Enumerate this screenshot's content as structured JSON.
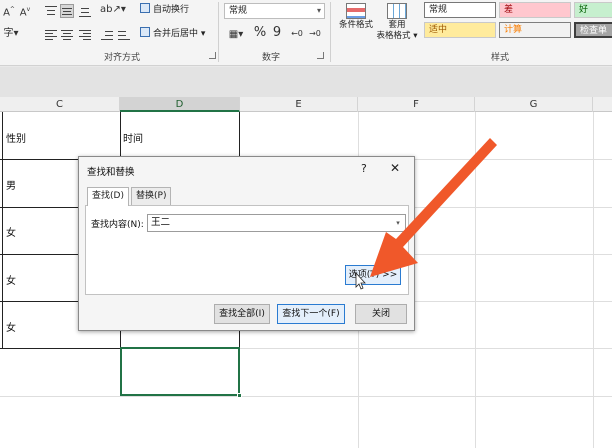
{
  "ribbon": {
    "wrap_text_label": "自动换行",
    "merge_center_label": "合并后居中",
    "alignment_group_label": "对齐方式",
    "number_format_value": "常规",
    "number_group_label": "数字",
    "percent_symbol": "%",
    "comma_symbol": "9",
    "conditional_format_line1": "条件格式",
    "format_table_line1": "套用",
    "format_table_line2": "表格格式",
    "styles_group_label": "样式",
    "styles": {
      "normal": "常规",
      "bad": "差",
      "good": "好",
      "neutral": "适中",
      "calculation": "计算",
      "check_cell": "检查单"
    },
    "colors": {
      "bad_bg": "#ffc7ce",
      "bad_fg": "#9c0006",
      "good_bg": "#c6efce",
      "good_fg": "#006100",
      "neutral_bg": "#ffeb9c",
      "neutral_fg": "#9c5700",
      "calc_bg": "#f2f2f2",
      "calc_fg": "#fa7d00",
      "check_bg": "#a5a5a5"
    }
  },
  "sheet": {
    "columns": [
      "C",
      "D",
      "E",
      "F",
      "G"
    ],
    "selected_column": "D",
    "header_gender": "性别",
    "header_time": "时间",
    "rows": [
      "男",
      "女",
      "女",
      "女"
    ]
  },
  "dialog": {
    "title": "查找和替换",
    "help": "?",
    "close": "✕",
    "tab_find": "查找(D)",
    "tab_replace": "替换(P)",
    "find_label": "查找内容(N):",
    "find_value": "王二",
    "options_button": "选项(T) >>",
    "find_all_button": "查找全部(I)",
    "find_next_button": "查找下一个(F)",
    "close_button": "关闭",
    "accent_color": "#2a7bd1"
  },
  "annotation": {
    "arrow_color": "#f0582a"
  }
}
